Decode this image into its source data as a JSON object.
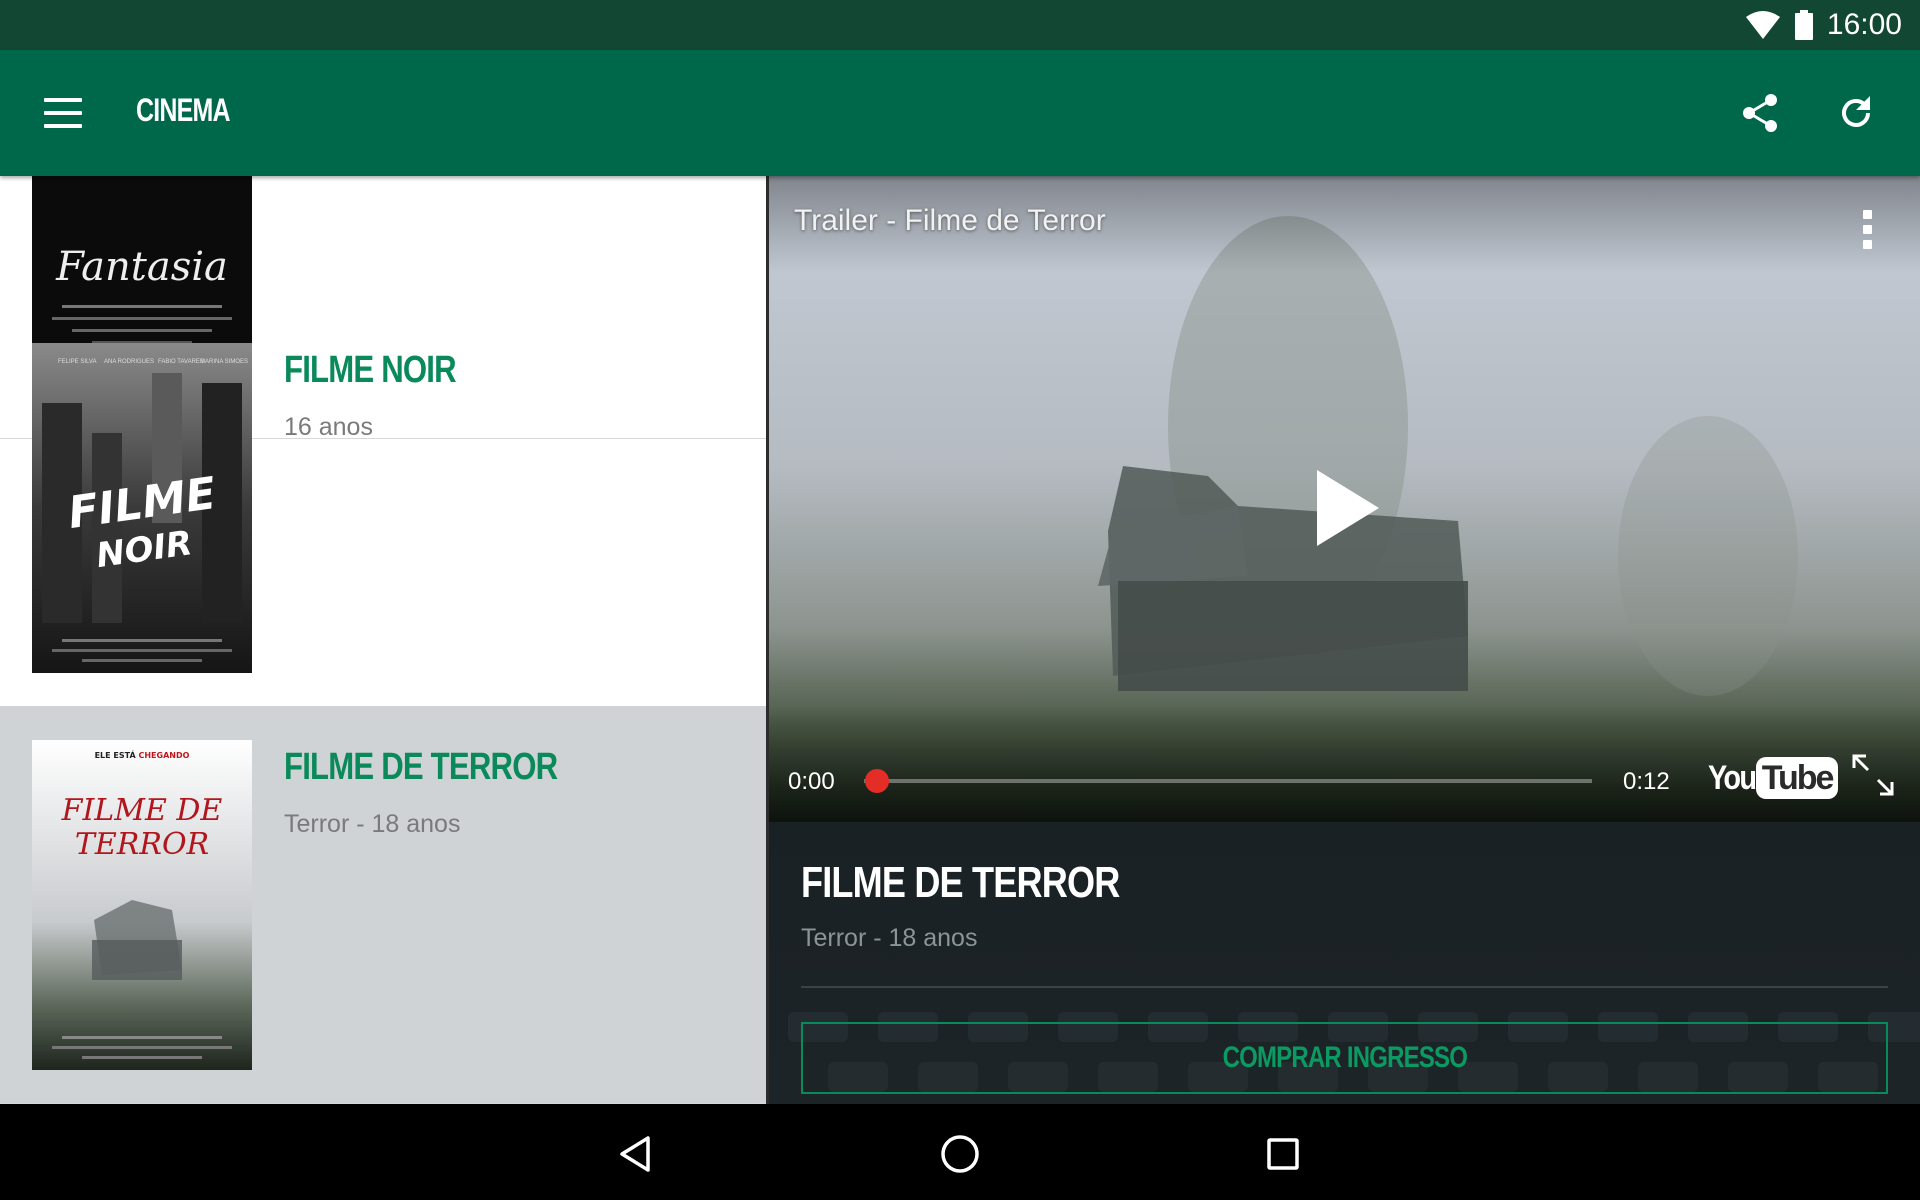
{
  "status_bar": {
    "time": "16:00",
    "icons": [
      "wifi-icon",
      "battery-icon"
    ]
  },
  "app_bar": {
    "title": "CINEMA",
    "actions": [
      "share-icon",
      "refresh-icon"
    ]
  },
  "movies": [
    {
      "name": "",
      "meta": "",
      "poster_text": "Fantasia",
      "selected": false
    },
    {
      "name": "FILME NOIR",
      "meta": "16 anos",
      "poster_text": "FILME NOIR",
      "poster_actors": [
        "FELIPE SILVA",
        "ANA RODRIGUES",
        "FABIO TAVARES",
        "MARINA SIMOES"
      ],
      "selected": false
    },
    {
      "name": "FILME DE TERROR",
      "meta": "Terror - 18 anos",
      "poster_text": "FILME DE TERROR",
      "poster_tagline_prefix": "ELE ESTÁ",
      "poster_tagline_highlight": "CHEGANDO",
      "selected": true
    }
  ],
  "player": {
    "title": "Trailer - Filme de Terror",
    "time_current": "0:00",
    "time_total": "0:12",
    "progress": 0.0,
    "logo_you": "You",
    "logo_tube": "Tube"
  },
  "detail": {
    "title": "FILME DE TERROR",
    "meta": "Terror - 18 anos",
    "buy_label": "COMPRAR INGRESSO"
  },
  "colors": {
    "status_bar": "#124734",
    "app_bar": "#00684a",
    "accent": "#0a8a5a",
    "selected_row": "#d0d3d6",
    "progress": "#e52d27"
  }
}
